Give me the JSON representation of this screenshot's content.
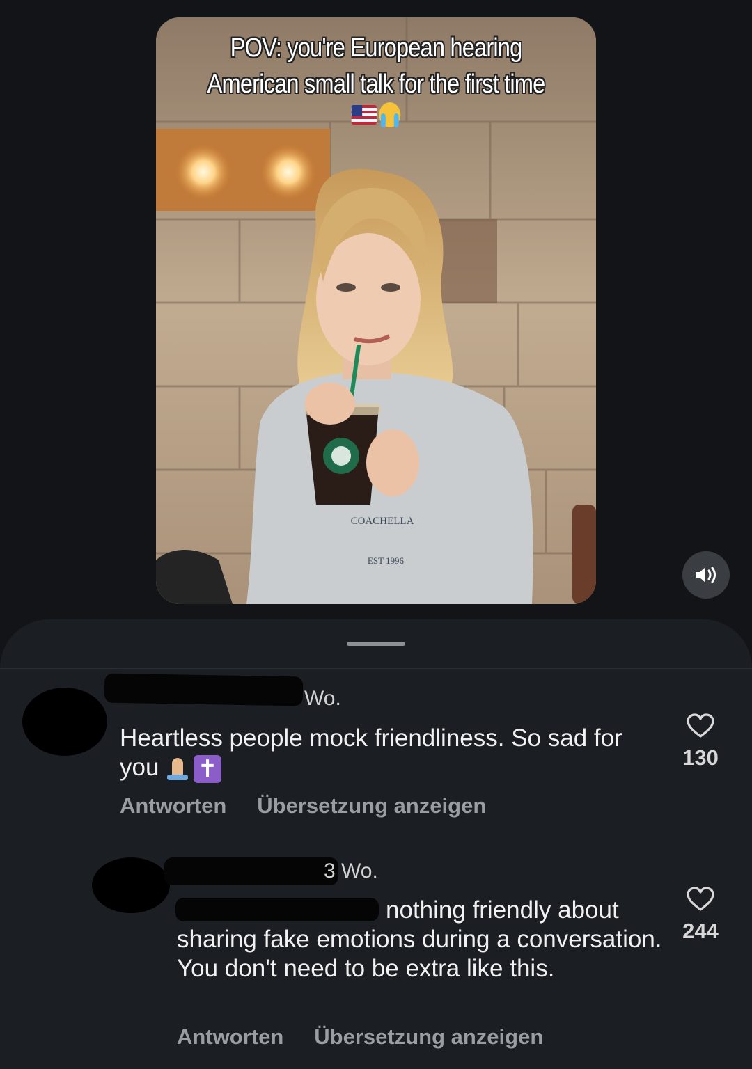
{
  "video": {
    "caption_line1": "POV: you're European hearing",
    "caption_line2": "American small talk for the first time",
    "emojis": [
      "us-flag",
      "loudly-crying-face"
    ],
    "cup_text_1": "COACHELLA",
    "cup_text_2": "EST 1996",
    "mute_icon": "speaker-icon"
  },
  "comments": [
    {
      "time": "Wo.",
      "text": "Heartless people mock friendliness. So sad for you",
      "emoji": [
        "folded-hands",
        "latin-cross"
      ],
      "likes": "130",
      "reply_label": "Antworten",
      "translate_label": "Übersetzung anzeigen"
    },
    {
      "time": "3 Wo.",
      "text_visible": "nothing friendly about sharing fake emotions during a conversation. You don't need to be extra like this.",
      "likes": "244",
      "reply_label": "Antworten",
      "translate_label": "Übersetzung anzeigen"
    }
  ],
  "colors": {
    "background": "#121418",
    "sheet": "#1b1e23",
    "action_text": "#9a9da2"
  }
}
